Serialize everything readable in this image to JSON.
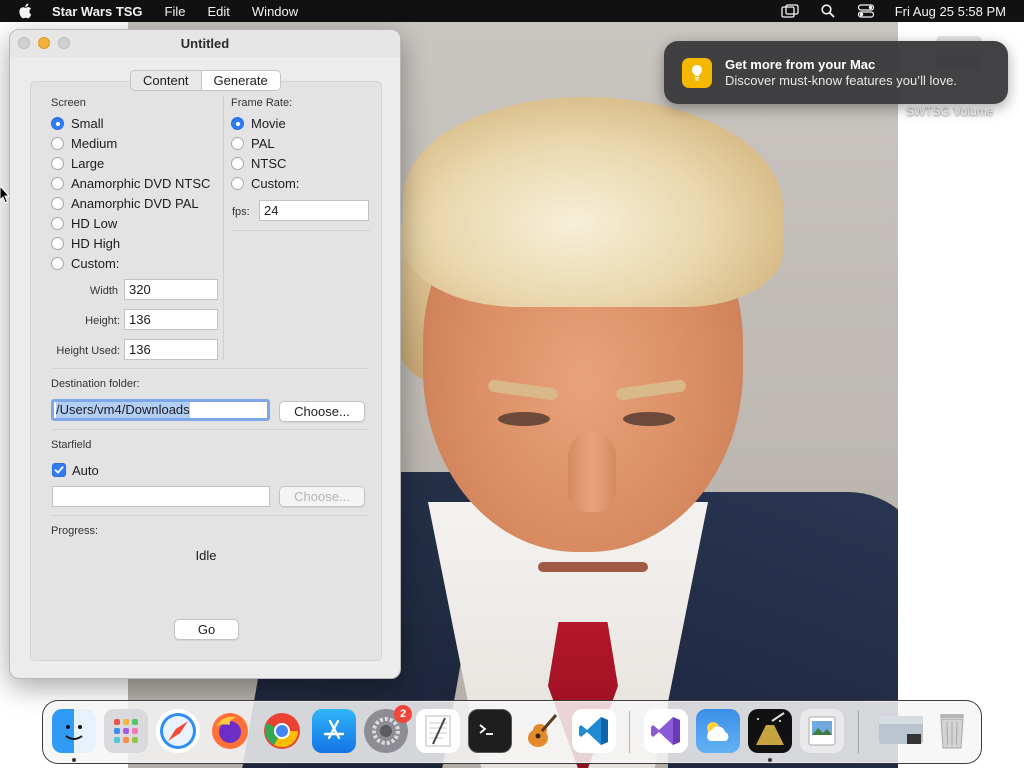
{
  "menubar": {
    "app_name": "Star Wars TSG",
    "menus": [
      "File",
      "Edit",
      "Window"
    ],
    "clock": "Fri Aug 25  5:58 PM"
  },
  "notification": {
    "title": "Get more from your Mac",
    "body": "Discover must-know features you’ll love."
  },
  "desktop": {
    "volume_label": "SWTSG Volume"
  },
  "window": {
    "title": "Untitled",
    "tabs": [
      "Content",
      "Generate"
    ],
    "active_tab": "Generate",
    "screen": {
      "label": "Screen",
      "options": [
        "Small",
        "Medium",
        "Large",
        "Anamorphic DVD NTSC",
        "Anamorphic DVD PAL",
        "HD Low",
        "HD High",
        "Custom:"
      ],
      "selected": "Small",
      "width_label": "Width",
      "width_value": "320",
      "height_label": "Height:",
      "height_value": "136",
      "height_used_label": "Height Used:",
      "height_used_value": "136"
    },
    "frame_rate": {
      "label": "Frame Rate:",
      "options": [
        "Movie",
        "PAL",
        "NTSC",
        "Custom:"
      ],
      "selected": "Movie",
      "fps_label": "fps:",
      "fps_value": "24"
    },
    "destination": {
      "label": "Destination folder:",
      "path": "/Users/vm4/Downloads",
      "choose_label": "Choose..."
    },
    "starfield": {
      "label": "Starfield",
      "auto_label": "Auto",
      "auto_checked": true,
      "path": "",
      "choose_label": "Choose..."
    },
    "progress": {
      "label": "Progress:",
      "status": "Idle"
    },
    "go_label": "Go"
  },
  "dock": {
    "items": [
      "Finder",
      "Launchpad",
      "Safari",
      "Firefox",
      "Chrome",
      "App Store",
      "System Settings",
      "TextEdit",
      "Terminal",
      "GarageBand",
      "Visual Studio Code",
      "Visual Studio",
      "Weather",
      "Star Wars TSG",
      "Preview",
      "Downloads",
      "Trash"
    ],
    "settings_badge": "2"
  },
  "colors": {
    "accent": "#2f7cf6",
    "menubar_bg": "#111111",
    "window_bg": "#ececec",
    "notification_bg": "#3a3a3c"
  }
}
